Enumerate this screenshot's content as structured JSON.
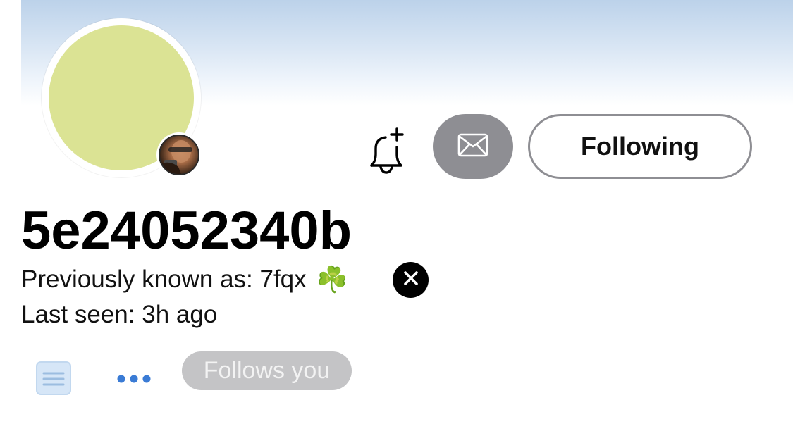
{
  "profile": {
    "username": "5e24052340b",
    "previously_known_label": "Previously known as: 7fqx",
    "previously_known_emoji": "☘️",
    "last_seen": "Last seen: 3h ago",
    "follows_you_badge": "Follows you"
  },
  "actions": {
    "following_label": "Following",
    "notify_icon": "bell-plus-icon",
    "message_icon": "envelope-icon",
    "dismiss_icon": "close-icon",
    "notes_icon": "document-icon",
    "more_icon": "more-horizontal-icon"
  },
  "colors": {
    "banner_top": "#bcd2ea",
    "avatar_fill": "#dbe394",
    "button_gray": "#8e8e93",
    "accent_blue": "#3a7bd5",
    "badge_gray": "#c4c4c6"
  }
}
